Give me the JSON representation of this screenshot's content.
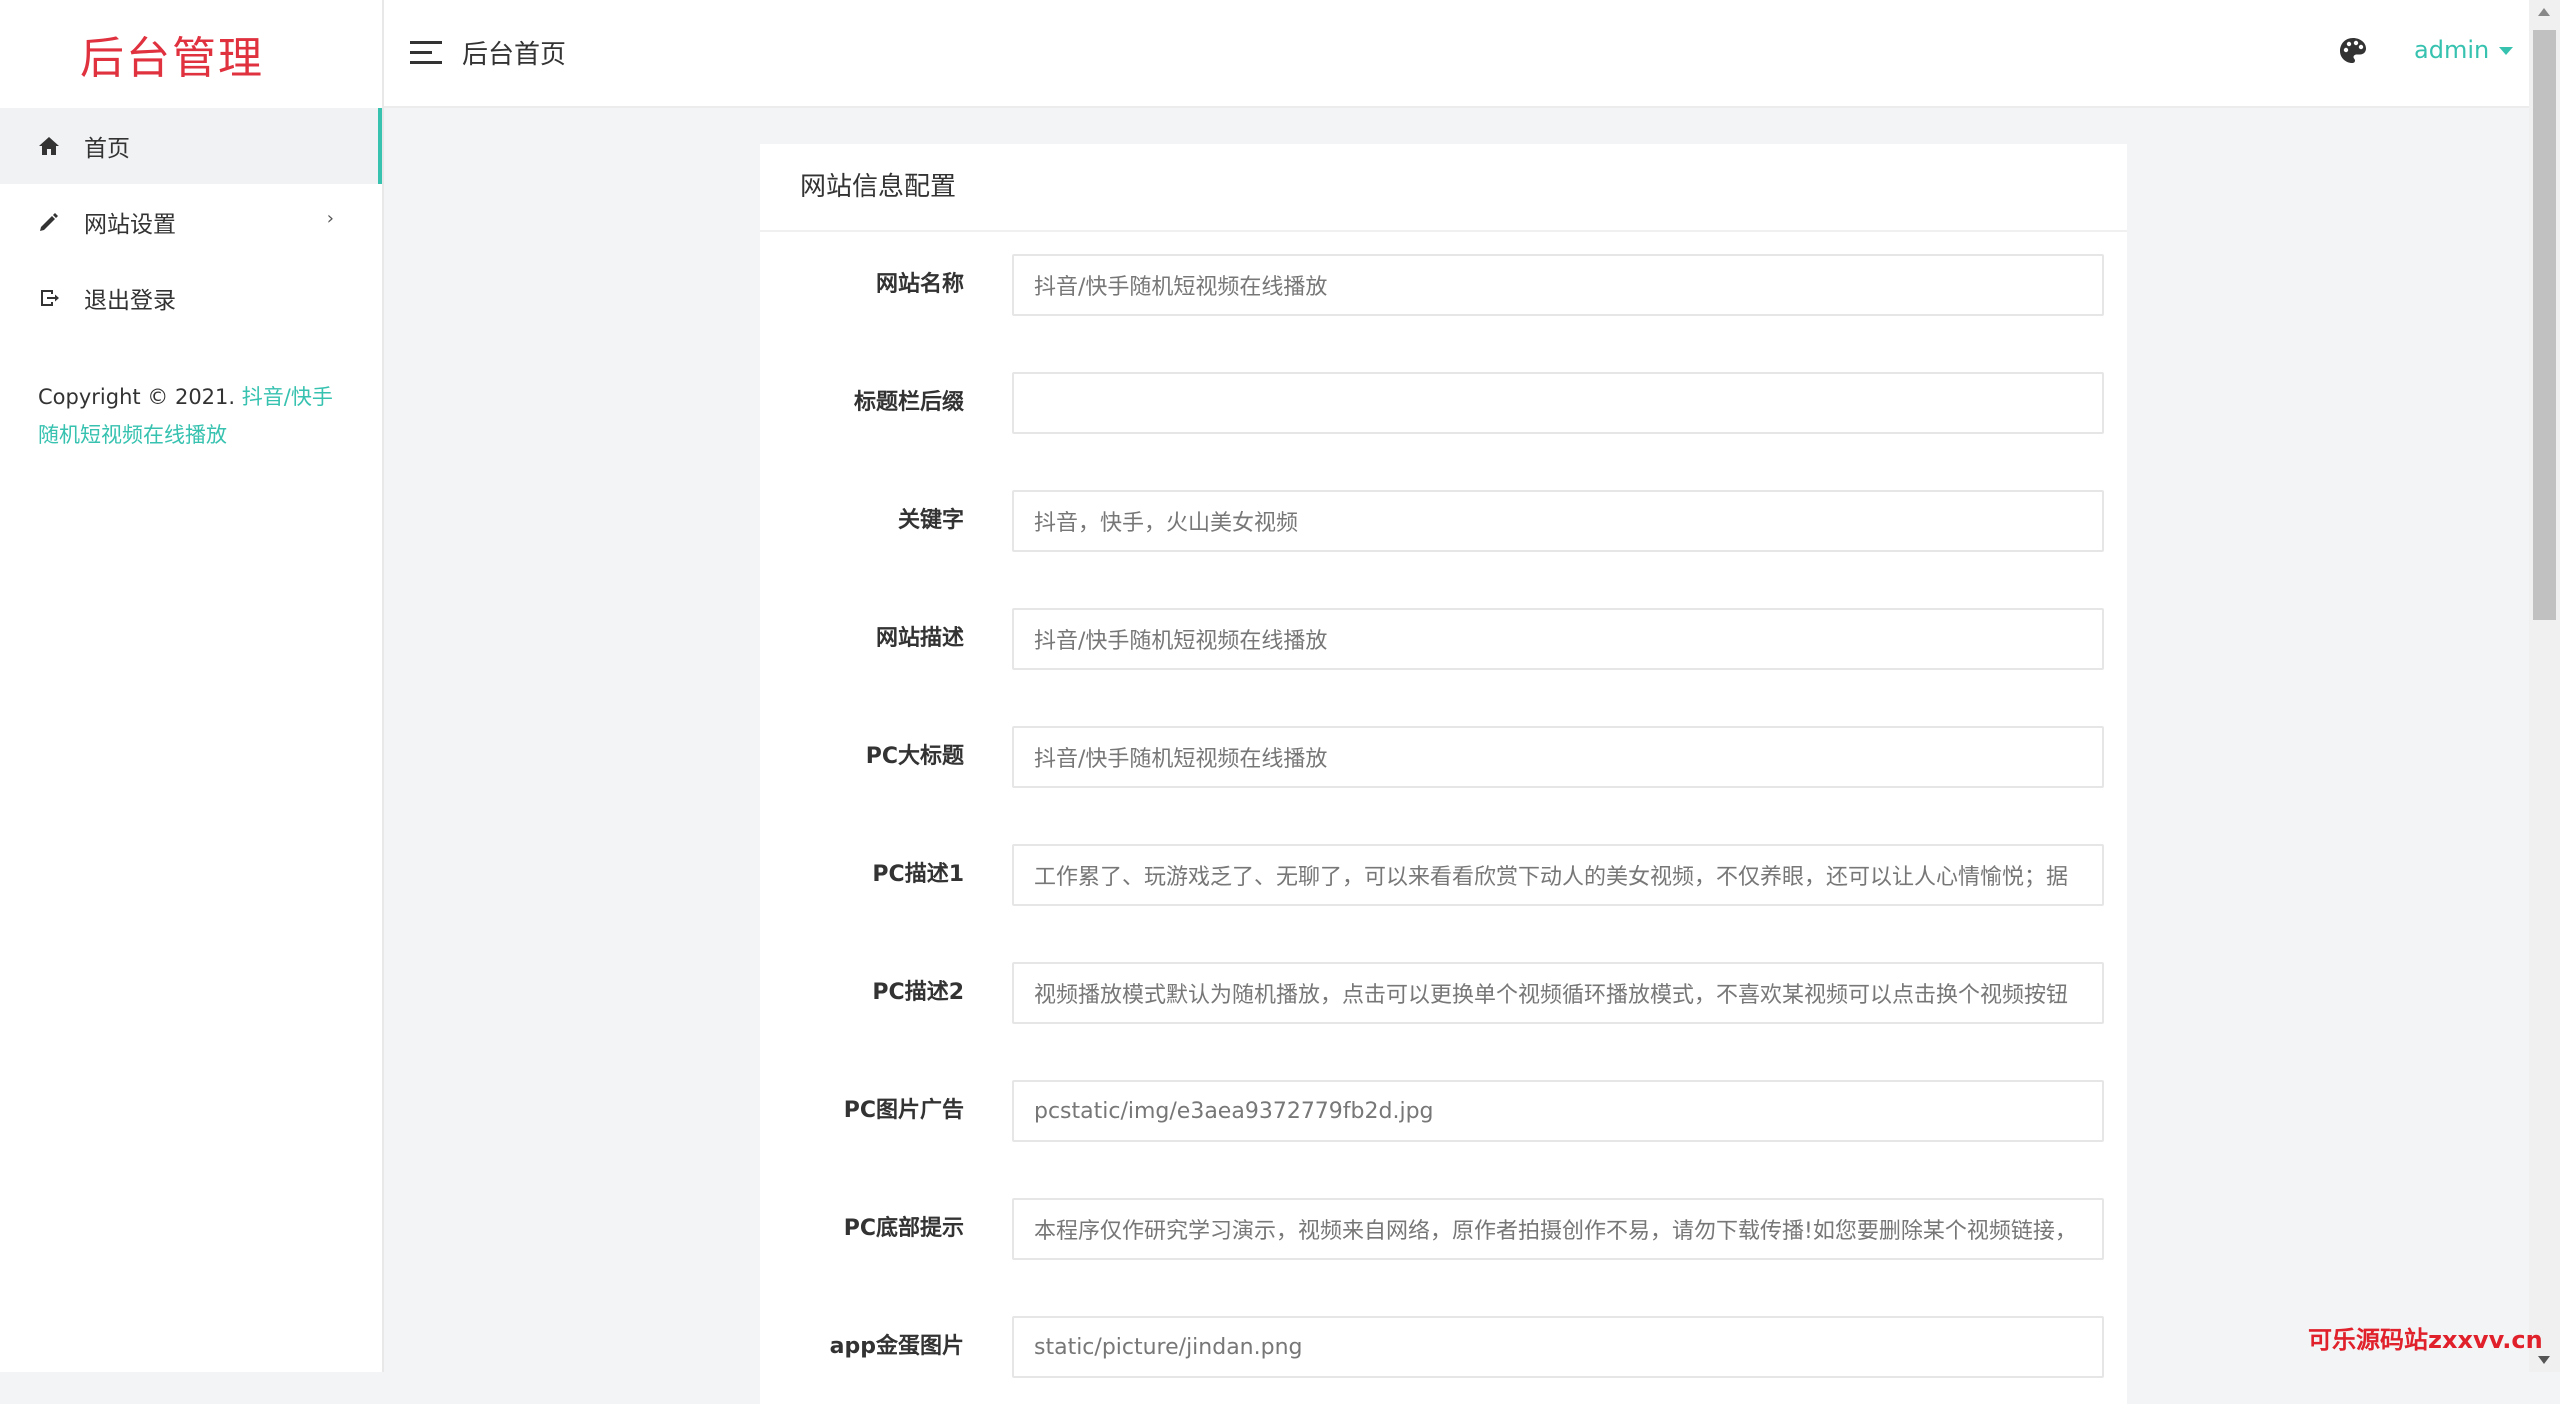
{
  "sidebar": {
    "logo": "后台管理",
    "items": [
      {
        "label": "首页",
        "icon": "home-icon",
        "active": true
      },
      {
        "label": "网站设置",
        "icon": "pencil-icon",
        "has_submenu": true
      },
      {
        "label": "退出登录",
        "icon": "logout-icon"
      }
    ],
    "chevron": "›",
    "copyright_prefix": "Copyright © 2021. ",
    "copyright_link": "抖音/快手随机短视频在线播放"
  },
  "header": {
    "title": "后台首页",
    "theme_icon": "palette-icon",
    "user": "admin"
  },
  "panel": {
    "title": "网站信息配置",
    "fields": [
      {
        "label": "网站名称",
        "value": "抖音/快手随机短视频在线播放"
      },
      {
        "label": "标题栏后缀",
        "value": ""
      },
      {
        "label": "关键字",
        "value": "抖音，快手，火山美女视频"
      },
      {
        "label": "网站描述",
        "value": "抖音/快手随机短视频在线播放"
      },
      {
        "label": "PC大标题",
        "value": "抖音/快手随机短视频在线播放"
      },
      {
        "label": "PC描述1",
        "value": "工作累了、玩游戏乏了、无聊了，可以来看看欣赏下动人的美女视频，不仅养眼，还可以让人心情愉悦；据"
      },
      {
        "label": "PC描述2",
        "value": "视频播放模式默认为随机播放，点击可以更换单个视频循环播放模式，不喜欢某视频可以点击换个视频按钮"
      },
      {
        "label": "PC图片广告",
        "value": "pcstatic/img/e3aea9372779fb2d.jpg"
      },
      {
        "label": "PC底部提示",
        "value": "本程序仅作研究学习演示，视频来自网络，原作者拍摄创作不易，请勿下载传播!如您要删除某个视频链接，"
      },
      {
        "label": "app金蛋图片",
        "value": "static/picture/jindan.png"
      }
    ]
  },
  "watermark": "可乐源码站zxxvv.cn",
  "colors": {
    "accent": "#37c2b0",
    "logo": "#e0313f",
    "watermark": "#e0202a"
  }
}
